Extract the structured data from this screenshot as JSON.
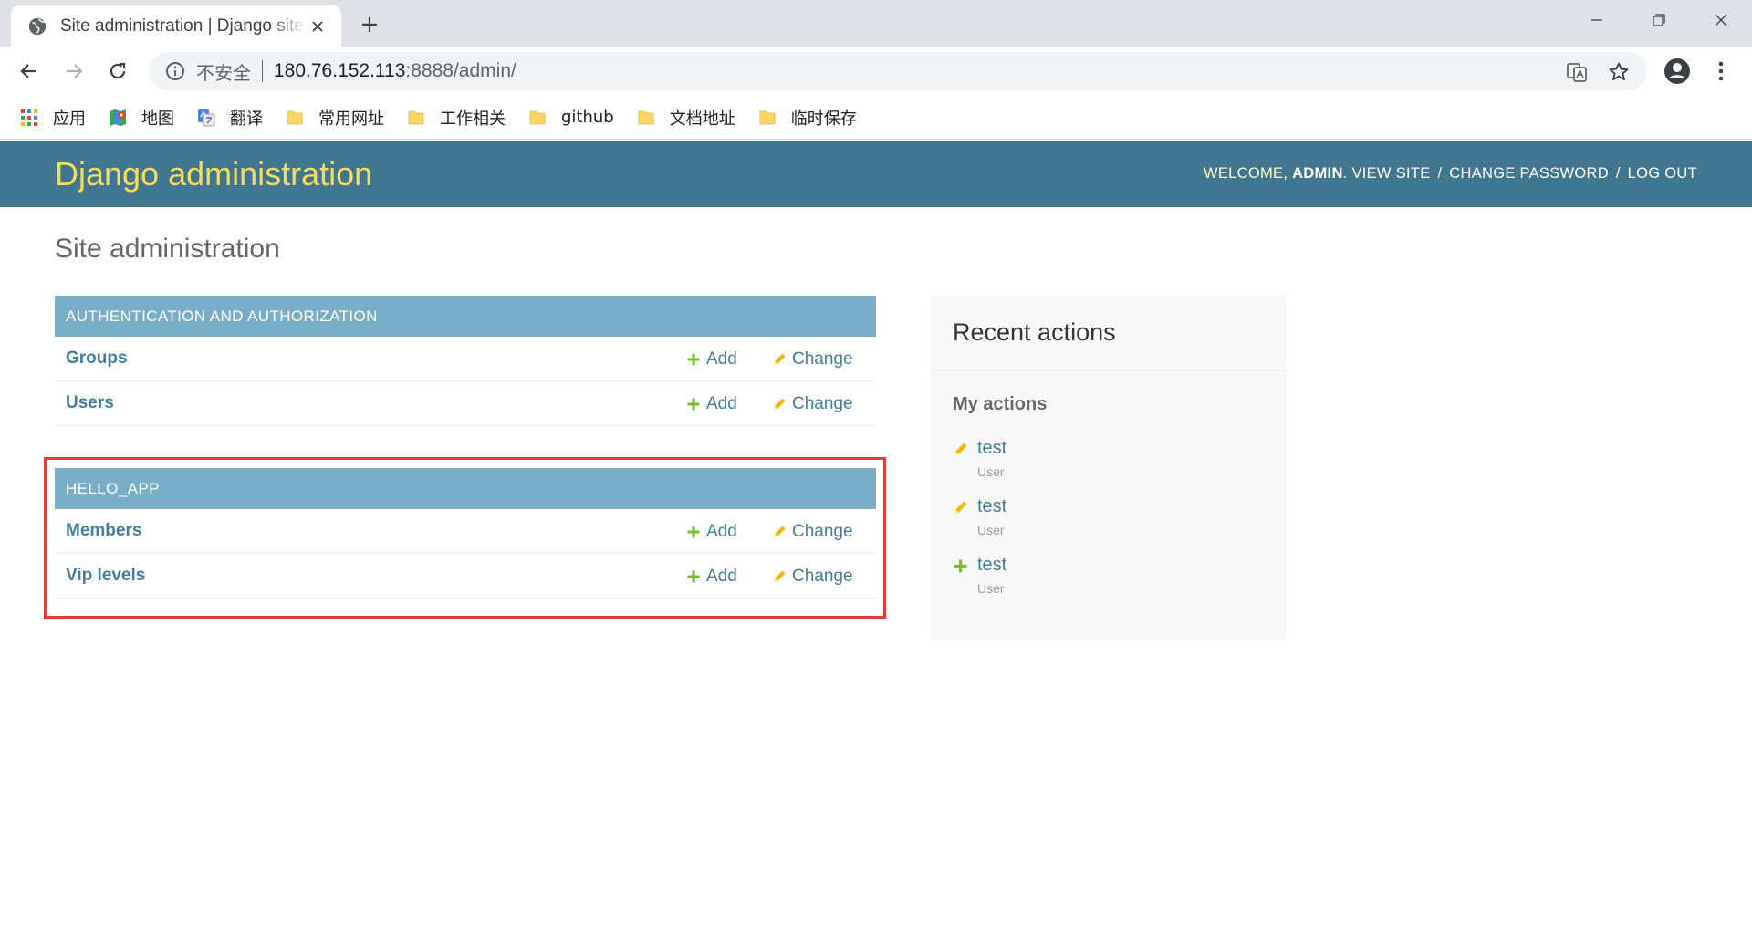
{
  "browser": {
    "tab_title": "Site administration | Django site admin",
    "security_label": "不安全",
    "url_host": "180.76.152.113",
    "url_rest": ":8888/admin/",
    "bookmarks": [
      {
        "label": "应用",
        "icon": "apps-grid-icon"
      },
      {
        "label": "地图",
        "icon": "maps-icon"
      },
      {
        "label": "翻译",
        "icon": "translate-icon"
      },
      {
        "label": "常用网址",
        "icon": "folder-icon"
      },
      {
        "label": "工作相关",
        "icon": "folder-icon"
      },
      {
        "label": "github",
        "icon": "folder-icon"
      },
      {
        "label": "文档地址",
        "icon": "folder-icon"
      },
      {
        "label": "临时保存",
        "icon": "folder-icon"
      }
    ]
  },
  "header": {
    "branding": "Django administration",
    "welcome": "WELCOME, ",
    "username": "ADMIN",
    "period": ".",
    "view_site": "VIEW SITE",
    "change_password": "CHANGE PASSWORD",
    "log_out": "LOG OUT",
    "slash": "/"
  },
  "page_title": "Site administration",
  "modules": [
    {
      "caption": "AUTHENTICATION AND AUTHORIZATION",
      "models": [
        {
          "name": "Groups",
          "add": "Add",
          "change": "Change"
        },
        {
          "name": "Users",
          "add": "Add",
          "change": "Change"
        }
      ]
    },
    {
      "caption": "HELLO_APP",
      "models": [
        {
          "name": "Members",
          "add": "Add",
          "change": "Change"
        },
        {
          "name": "Vip levels",
          "add": "Add",
          "change": "Change"
        }
      ]
    }
  ],
  "recent_actions": {
    "title": "Recent actions",
    "subtitle": "My actions",
    "items": [
      {
        "action": "change",
        "object": "test",
        "type": "User"
      },
      {
        "action": "change",
        "object": "test",
        "type": "User"
      },
      {
        "action": "add",
        "object": "test",
        "type": "User"
      }
    ]
  },
  "colors": {
    "header_bg": "#417690",
    "branding": "#f5dd5d",
    "caption_bg": "#79aec8",
    "link": "#447e9b",
    "add_icon": "#70bf2b",
    "change_icon": "#efb80b",
    "highlight": "#e53935"
  }
}
